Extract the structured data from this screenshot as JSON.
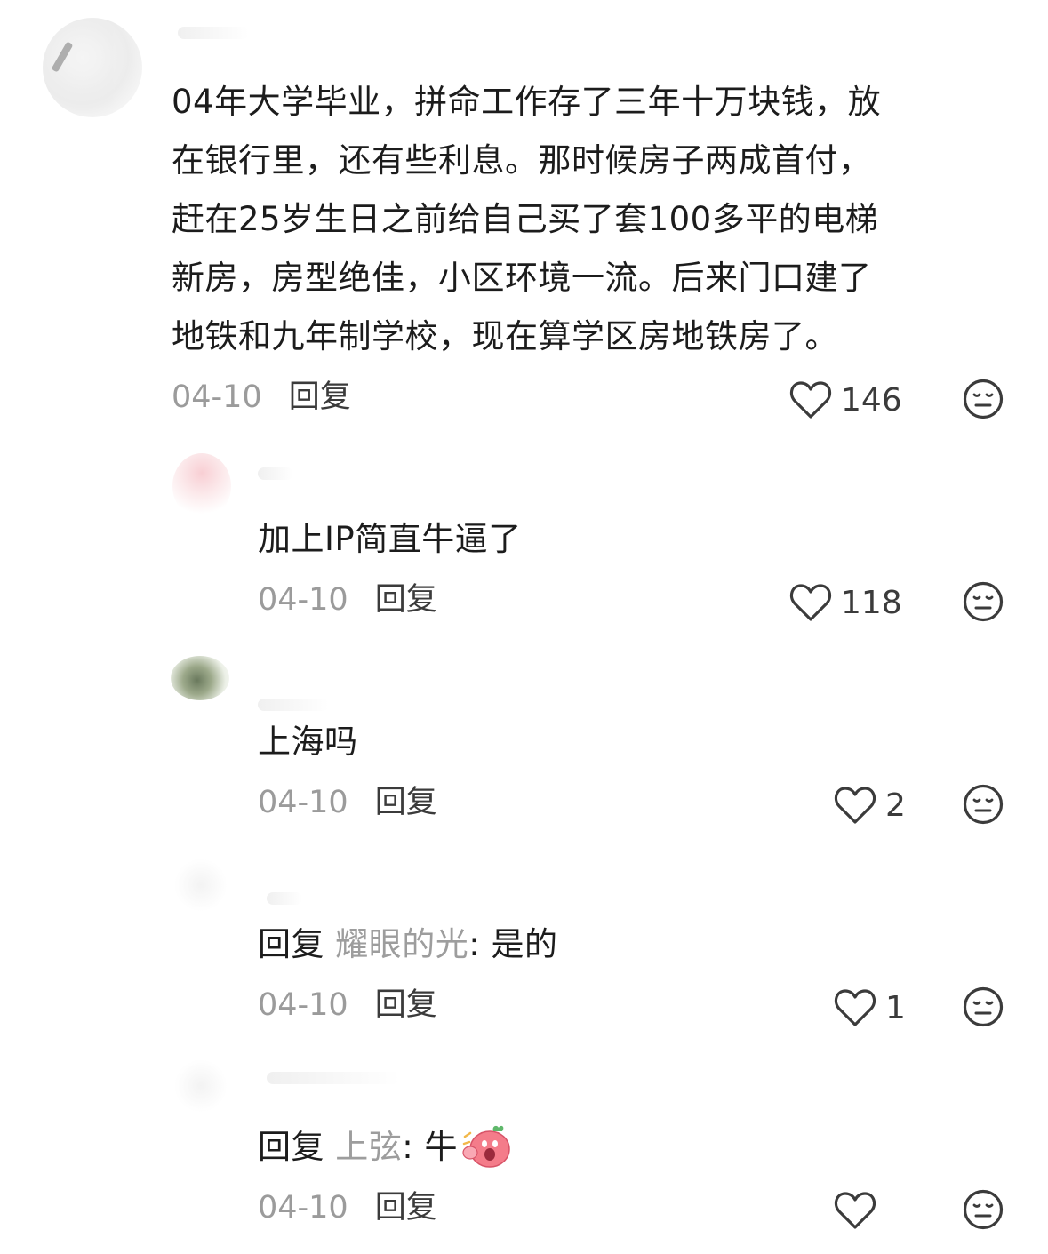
{
  "comments": [
    {
      "lines": [
        "04年大学毕业，拼命工作存了三年十万块钱，放",
        "在银行里，还有些利息。那时候房子两成首付，",
        "赶在25岁生日之前给自己买了套100多平的电梯",
        "新房，房型绝佳，小区环境一流。后来门口建了",
        "地铁和九年制学校，现在算学区房地铁房了。"
      ],
      "date": "04-10",
      "reply_label": "回复",
      "likes": "146"
    },
    {
      "text": "加上IP简直牛逼了",
      "date": "04-10",
      "reply_label": "回复",
      "likes": "118"
    },
    {
      "text": "上海吗",
      "date": "04-10",
      "reply_label": "回复",
      "likes": "2"
    },
    {
      "reply_prefix": "回复",
      "reply_target": "耀眼的光",
      "reply_body": ": 是的",
      "date": "04-10",
      "reply_label": "回复",
      "likes": "1"
    },
    {
      "reply_prefix": "回复",
      "reply_target": "上弦",
      "reply_body": ": 牛",
      "emoji": "pink-blob-emoji",
      "date": "04-10",
      "reply_label": "回复"
    }
  ],
  "icons": {
    "like": "heart-outline-icon",
    "dislike": "meh-face-icon"
  },
  "colors": {
    "text": "#1c1c1c",
    "muted": "#9b9b9b",
    "icon": "#3b3b3b"
  }
}
